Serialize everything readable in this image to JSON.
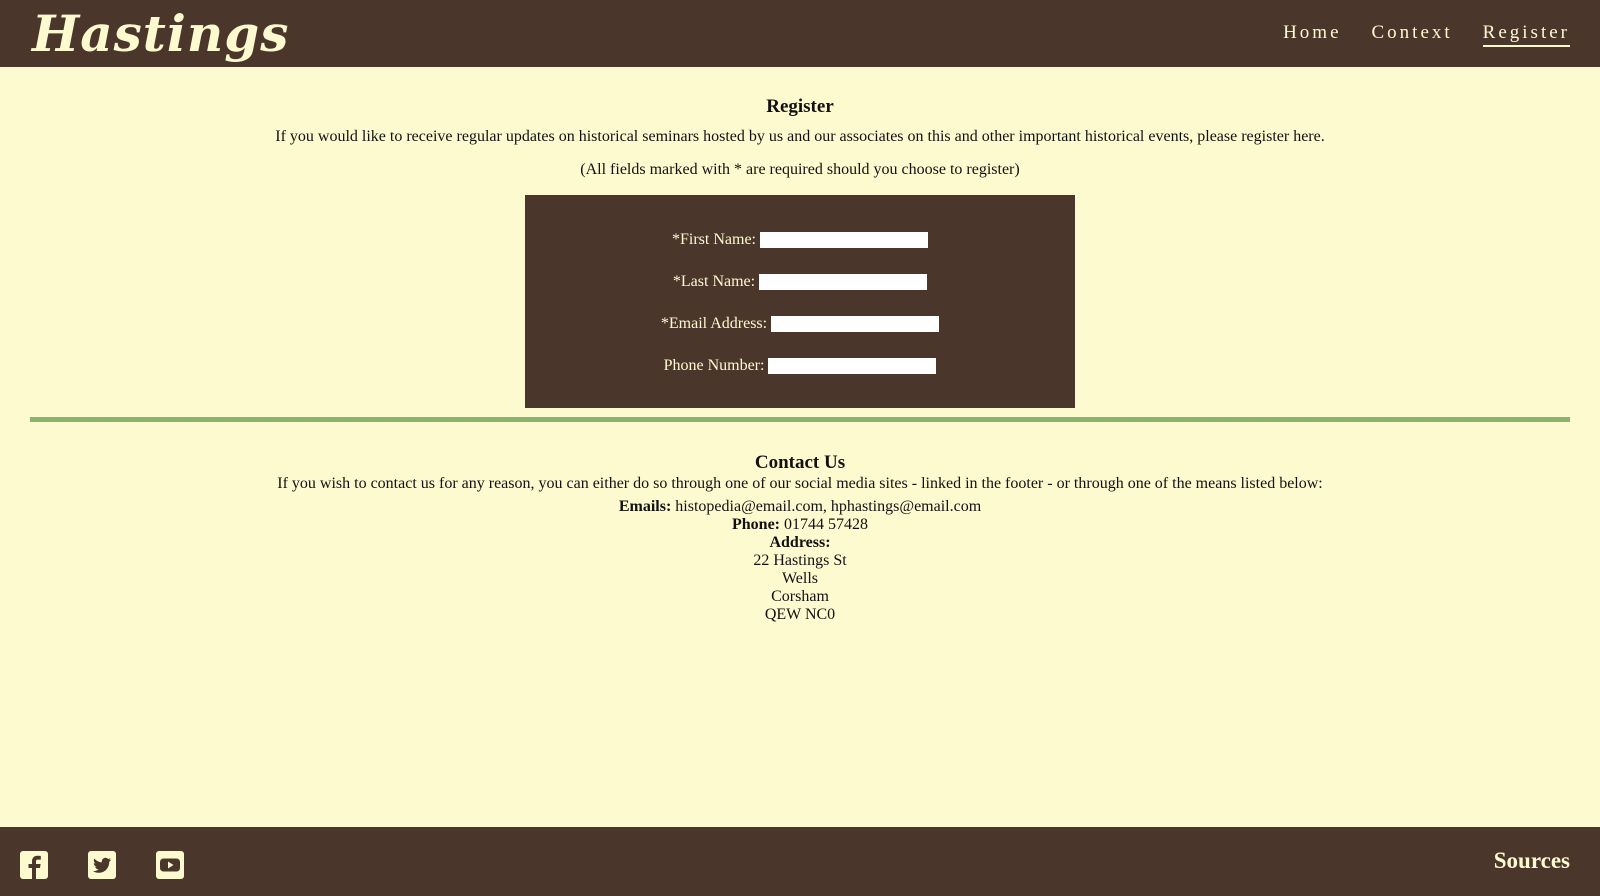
{
  "header": {
    "logo": "Hastings",
    "nav": [
      {
        "label": "Home"
      },
      {
        "label": "Context"
      },
      {
        "label": "Register"
      }
    ]
  },
  "register": {
    "heading": "Register",
    "intro": "If you would like to receive regular updates on historical seminars hosted by us and our associates on this and other important historical events, please register here.",
    "note": "(All fields marked with * are required should you choose to register)",
    "fields": [
      {
        "label": "*First Name:",
        "value": ""
      },
      {
        "label": "*Last Name:",
        "value": ""
      },
      {
        "label": "*Email Address:",
        "value": ""
      },
      {
        "label": "Phone Number:",
        "value": ""
      }
    ]
  },
  "contact": {
    "heading": "Contact Us",
    "intro": "If you wish to contact us for any reason, you can either do so through one of our social media sites - linked in the footer - or through one of the means listed below:",
    "emails_label": "Emails:",
    "emails_value": "histopedia@email.com, hphastings@email.com",
    "phone_label": "Phone:",
    "phone_value": "01744 57428",
    "address_label": "Address:",
    "address_lines": [
      "22 Hastings St",
      "Wells",
      "Corsham",
      "QEW NC0"
    ]
  },
  "footer": {
    "social_icons": [
      "facebook-icon",
      "twitter-icon",
      "youtube-icon"
    ],
    "sources_label": "Sources"
  },
  "colors": {
    "background": "#fefad0",
    "dark_brown": "#4a362a",
    "divider_green": "#8ab46a"
  }
}
